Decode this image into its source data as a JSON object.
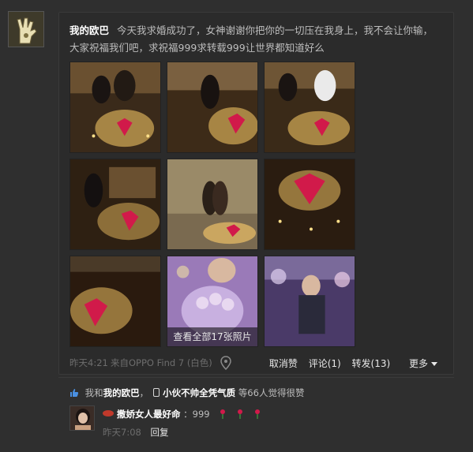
{
  "post": {
    "author": "我的欧巴",
    "text": "今天我求婚成功了，女神谢谢你把你的一切压在我身上，我不会让你输，大家祝福我们吧，求祝福999求转载999让世界都知道好么",
    "photo_overlay": "查看全部17张照片",
    "time": "昨天4:21",
    "source": "来自OPPO Find 7 (白色)",
    "location_icon": "location-pin-icon"
  },
  "actions": {
    "collect": "取消赞",
    "comment": "评论(1)",
    "forward": "转发(13)",
    "more": "更多"
  },
  "likes": {
    "prefix": "我和",
    "friend1": "我的欧巴",
    "sep": "，",
    "friend2": "小伙不帅全凭气质",
    "count_text": "等66人",
    "suffix": "觉得很赞"
  },
  "comment": {
    "name": "撒娇女人最好命",
    "content": "：999",
    "time": "昨天7:08",
    "reply": "回复"
  },
  "colors": {
    "background": "#2f2f2f",
    "card": "#2b2b2b",
    "heart": "#d11a4a",
    "candle": "#ffcf6a"
  }
}
